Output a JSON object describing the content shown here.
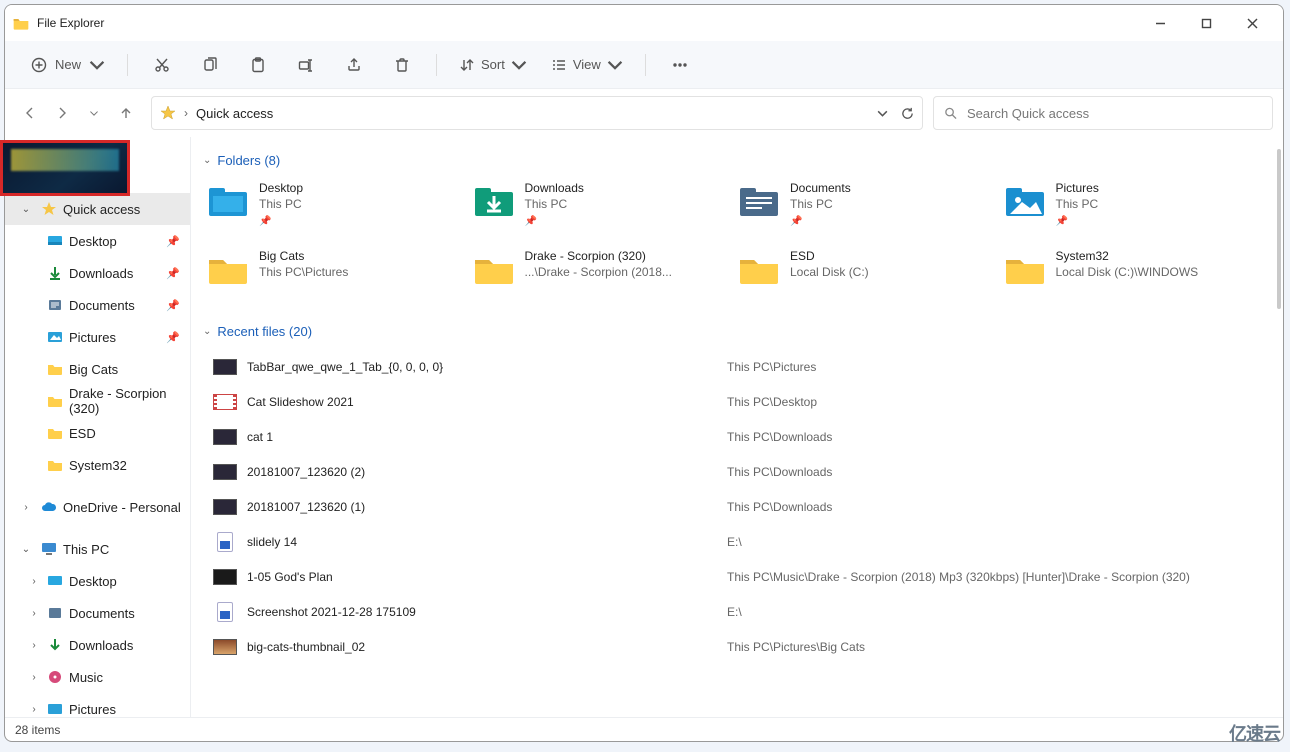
{
  "title": "File Explorer",
  "toolbar": {
    "new": "New",
    "sort": "Sort",
    "view": "View"
  },
  "breadcrumb": {
    "root": "Quick access"
  },
  "search": {
    "placeholder": "Search Quick access"
  },
  "sidebar": {
    "quick_access": "Quick access",
    "items": [
      {
        "label": "Desktop",
        "pinned": true
      },
      {
        "label": "Downloads",
        "pinned": true
      },
      {
        "label": "Documents",
        "pinned": true
      },
      {
        "label": "Pictures",
        "pinned": true
      },
      {
        "label": "Big Cats",
        "pinned": false
      },
      {
        "label": "Drake - Scorpion (320)",
        "pinned": false
      },
      {
        "label": "ESD",
        "pinned": false
      },
      {
        "label": "System32",
        "pinned": false
      }
    ],
    "onedrive": "OneDrive - Personal",
    "this_pc": "This PC",
    "pc_items": [
      {
        "label": "Desktop"
      },
      {
        "label": "Documents"
      },
      {
        "label": "Downloads"
      },
      {
        "label": "Music"
      },
      {
        "label": "Pictures"
      }
    ]
  },
  "sections": {
    "folders_header": "Folders (8)",
    "recent_header": "Recent files (20)"
  },
  "folders": [
    {
      "name": "Desktop",
      "sub": "This PC",
      "pinned": true,
      "color": "blue"
    },
    {
      "name": "Downloads",
      "sub": "This PC",
      "pinned": true,
      "color": "teal"
    },
    {
      "name": "Documents",
      "sub": "This PC",
      "pinned": true,
      "color": "slate"
    },
    {
      "name": "Pictures",
      "sub": "This PC",
      "pinned": true,
      "color": "cyan"
    },
    {
      "name": "Big Cats",
      "sub": "This PC\\Pictures",
      "pinned": false,
      "color": "yellow"
    },
    {
      "name": "Drake - Scorpion (320)",
      "sub": "...\\Drake - Scorpion (2018...",
      "pinned": false,
      "color": "yellow"
    },
    {
      "name": "ESD",
      "sub": "Local Disk (C:)",
      "pinned": false,
      "color": "yellow"
    },
    {
      "name": "System32",
      "sub": "Local Disk (C:)\\WINDOWS",
      "pinned": false,
      "color": "yellow"
    }
  ],
  "files": [
    {
      "name": "TabBar_qwe_qwe_1_Tab_{0, 0, 0, 0}",
      "path": "This PC\\Pictures",
      "icon": "thumb"
    },
    {
      "name": "Cat Slideshow 2021",
      "path": "This PC\\Desktop",
      "icon": "film"
    },
    {
      "name": "cat 1",
      "path": "This PC\\Downloads",
      "icon": "thumb"
    },
    {
      "name": "20181007_123620 (2)",
      "path": "This PC\\Downloads",
      "icon": "thumb"
    },
    {
      "name": "20181007_123620 (1)",
      "path": "This PC\\Downloads",
      "icon": "thumb"
    },
    {
      "name": "slidely 14",
      "path": "E:\\",
      "icon": "page-pic"
    },
    {
      "name": "1-05 God's Plan",
      "path": "This PC\\Music\\Drake - Scorpion (2018) Mp3 (320kbps) [Hunter]\\Drake - Scorpion (320)",
      "icon": "dark"
    },
    {
      "name": "Screenshot 2021-12-28 175109",
      "path": "E:\\",
      "icon": "page-pic"
    },
    {
      "name": "big-cats-thumbnail_02",
      "path": "This PC\\Pictures\\Big Cats",
      "icon": "shoe"
    }
  ],
  "status": "28 items",
  "watermark": "亿速云"
}
